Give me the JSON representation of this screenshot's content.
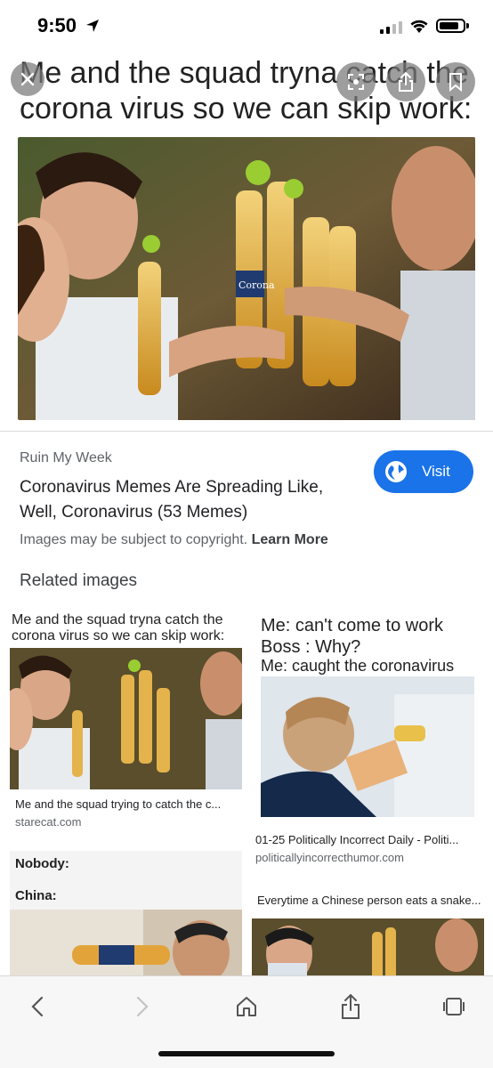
{
  "status_bar": {
    "time": "9:50",
    "icons": [
      "location-arrow-icon",
      "cellular-signal-icon",
      "wifi-icon",
      "battery-icon"
    ]
  },
  "viewer": {
    "caption": "Me and the squad tryna catch the corona virus so we can skip work:",
    "close_icon": "close-icon",
    "lens_icon": "lens-icon",
    "share_icon": "share-icon",
    "bookmark_icon": "bookmark-icon",
    "bottle_label": "Corona"
  },
  "result": {
    "source": "Ruin My Week",
    "title": "Coronavirus Memes Are Spreading Like, Well, Coronavirus (53 Memes)",
    "visit_label": "Visit",
    "copyright_text": "Images may be subject to copyright.",
    "learn_more": "Learn More"
  },
  "related": {
    "heading": "Related images",
    "items": [
      {
        "image_caption": "Me and the squad tryna catch the corona virus so we can skip work:",
        "title": "Me and the squad trying to catch the c...",
        "site": "starecat.com"
      },
      {
        "image_lines": [
          "Me: can't come to work",
          "Boss : Why?",
          "Me: caught the coronavirus"
        ],
        "title": "01-25 Politically Incorrect Daily - Politi...",
        "site": "politicallyincorrecthumor.com"
      },
      {
        "image_lines": [
          "Nobody:",
          "China:"
        ]
      },
      {
        "image_caption": "Everytime a Chinese person eats a snake..."
      }
    ]
  },
  "toolbar": {
    "icons": [
      "back-icon",
      "forward-icon",
      "home-icon",
      "share-icon",
      "tabs-icon"
    ]
  },
  "colors": {
    "accent": "#1a73e8",
    "text_primary": "#202124",
    "text_secondary": "#5f6368"
  }
}
